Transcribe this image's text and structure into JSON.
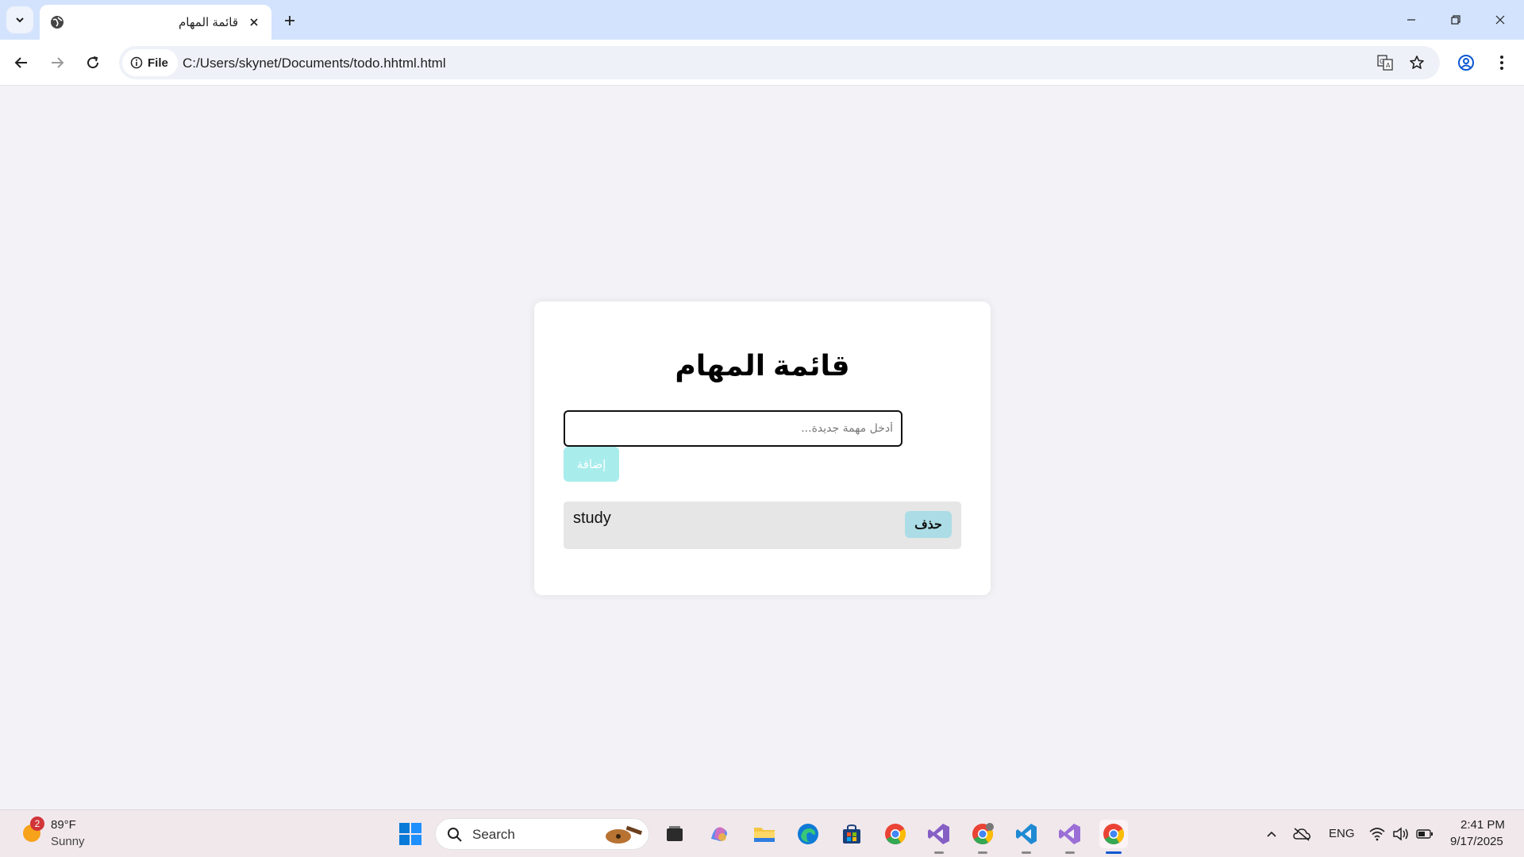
{
  "browser": {
    "tab_title": "قائمة المهام",
    "site_label": "File",
    "url": "C:/Users/skynet/Documents/todo.hhtml.html"
  },
  "page": {
    "title": "قائمة المهام",
    "input_placeholder": "أدخل مهمة جديدة...",
    "add_label": "إضافة",
    "tasks": [
      {
        "text": "study",
        "delete_label": "حذف"
      }
    ],
    "colors": {
      "add_button": "#a8ecec",
      "delete_button": "#acdde6",
      "task_background": "#e6e6e6"
    }
  },
  "taskbar": {
    "weather_temp": "89°F",
    "weather_condition": "Sunny",
    "weather_badge": "2",
    "search_label": "Search",
    "language": "ENG",
    "time": "2:41 PM",
    "date": "9/17/2025"
  }
}
